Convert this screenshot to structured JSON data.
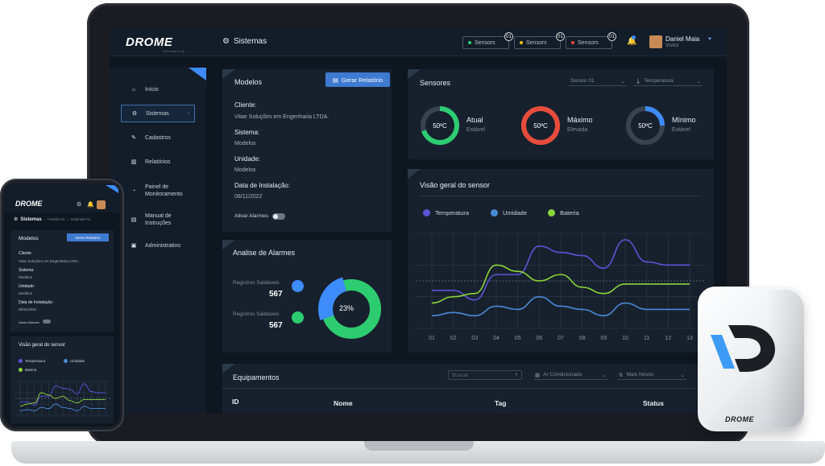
{
  "brand": {
    "name": "DROME",
    "sub": "telemetria"
  },
  "header": {
    "title": "Sistemas",
    "chips": [
      {
        "label": "Sensors",
        "count": "01",
        "color": "#2ecc71"
      },
      {
        "label": "Sensors",
        "count": "01",
        "color": "#f1c40f"
      },
      {
        "label": "Sensors",
        "count": "01",
        "color": "#e74c3c"
      }
    ],
    "user": {
      "name": "Daniel Maia",
      "role": "Visitor"
    }
  },
  "sidebar": {
    "items": [
      {
        "label": "Início"
      },
      {
        "label": "Sistemas"
      },
      {
        "label": "Cadastros"
      },
      {
        "label": "Relatórios"
      },
      {
        "label": "Painel de Monitoramento"
      },
      {
        "label": "Manual de Instruções"
      },
      {
        "label": "Administrativo"
      }
    ]
  },
  "modelos": {
    "title": "Modelos",
    "button": "Gerar Relatório",
    "cliente_label": "Cliente:",
    "cliente_value": "Vitae Soluções em Engenharia LTDA.",
    "sistema_label": "Sistema:",
    "sistema_value": "Modelos",
    "unidade_label": "Unidade:",
    "unidade_value": "Modelos",
    "data_label": "Data de Instalação:",
    "data_value": "08/11/2022",
    "alarm_label": "Ativar Alarmes"
  },
  "sensores": {
    "title": "Sensores",
    "select1": "Sensor 01",
    "select2": "Temperatura",
    "rings": [
      {
        "value": "50ºC",
        "label": "Atual",
        "sub": "Estável",
        "color": "#2ecc71",
        "fraction": 0.7
      },
      {
        "value": "50ºC",
        "label": "Máximo",
        "sub": "Elevada",
        "color": "#e74c3c",
        "fraction": 1.0
      },
      {
        "value": "50ºC",
        "label": "Mínimo",
        "sub": "Estável",
        "color": "#3d8bfd",
        "fraction": 0.25
      }
    ]
  },
  "alarmes": {
    "title": "Analise de Alarmes",
    "rows": [
      {
        "label": "Registros Saldáveis",
        "value": "567",
        "color": "#3d8bfd"
      },
      {
        "label": "Registros Saldáveis",
        "value": "567",
        "color": "#2ecc71"
      }
    ],
    "donut_label": "23%"
  },
  "visao": {
    "title": "Visão geral do sensor",
    "legend": [
      {
        "name": "Temperatura",
        "color": "#5b54d6"
      },
      {
        "name": "Umidade",
        "color": "#4a8ad6"
      },
      {
        "name": "Bateria",
        "color": "#8bd43a"
      }
    ]
  },
  "chart_data": {
    "type": "line",
    "categories": [
      "01",
      "02",
      "03",
      "04",
      "05",
      "06",
      "07",
      "08",
      "09",
      "10",
      "11",
      "12",
      "13"
    ],
    "series": [
      {
        "name": "Temperatura",
        "values": [
          64,
          64,
          58,
          74,
          74,
          92,
          88,
          86,
          78,
          96,
          82,
          80,
          80
        ]
      },
      {
        "name": "Umidade",
        "values": [
          48,
          50,
          48,
          54,
          52,
          60,
          54,
          52,
          48,
          56,
          52,
          52,
          52
        ]
      },
      {
        "name": "Bateria",
        "values": [
          56,
          60,
          62,
          80,
          76,
          70,
          74,
          66,
          62,
          68,
          68,
          68,
          68
        ]
      }
    ],
    "ylim": [
      40,
      100
    ]
  },
  "equipamentos": {
    "title": "Equipamentos",
    "search_placeholder": "Buscar",
    "filter1": "Ar Condicionado",
    "filter2": "Mais Novos",
    "columns": [
      "ID",
      "Nome",
      "Tag",
      "Status"
    ]
  },
  "phone": {
    "breadcrumb_root": "Sistemas",
    "breadcrumb_1": "Família 01",
    "breadcrumb_2": "Gabinete 01"
  },
  "device": {
    "label": "DROME"
  }
}
